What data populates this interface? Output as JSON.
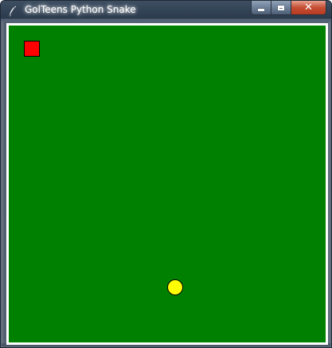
{
  "window": {
    "title": "GolTeens Python Snake",
    "app_icon": "feather-icon",
    "controls": {
      "minimize_icon": "minimize-icon",
      "maximize_icon": "maximize-icon",
      "close_icon": "close-icon",
      "close_glyph": "✕"
    }
  },
  "game": {
    "background_color": "#008000",
    "snake": {
      "segment_color": "#ff0000",
      "segments": 1
    },
    "food": {
      "color": "#ffff00",
      "shape": "circle"
    }
  }
}
